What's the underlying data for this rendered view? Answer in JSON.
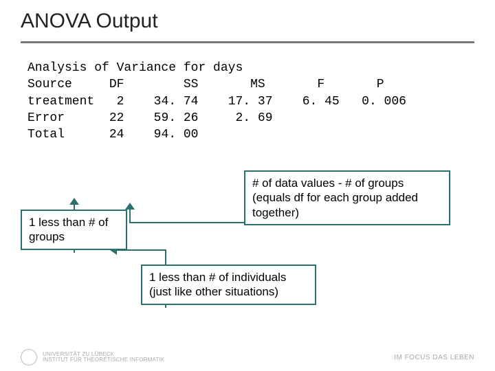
{
  "title": "ANOVA Output",
  "anova": {
    "heading": "Analysis of Variance for days",
    "columns": [
      "Source",
      "DF",
      "SS",
      "MS",
      "F",
      "P"
    ],
    "rows": [
      {
        "source": "treatment",
        "df": "2",
        "ss": "34. 74",
        "ms": "17. 37",
        "f": "6. 45",
        "p": "0. 006"
      },
      {
        "source": "Error",
        "df": "22",
        "ss": "59. 26",
        "ms": "2. 69",
        "f": "",
        "p": ""
      },
      {
        "source": "Total",
        "df": "24",
        "ss": "94. 00",
        "ms": "",
        "f": "",
        "p": ""
      }
    ]
  },
  "callouts": {
    "left": "1 less than # of groups",
    "right": "# of data values - # of groups (equals df for each group added together)",
    "bottom": "1 less than # of individuals (just like other situations)"
  },
  "footer": {
    "institution_line1": "UNIVERSITÄT ZU LÜBECK",
    "institution_line2": "INSTITUT FÜR THEORETISCHE INFORMATIK",
    "motto": "IM FOCUS DAS LEBEN"
  }
}
